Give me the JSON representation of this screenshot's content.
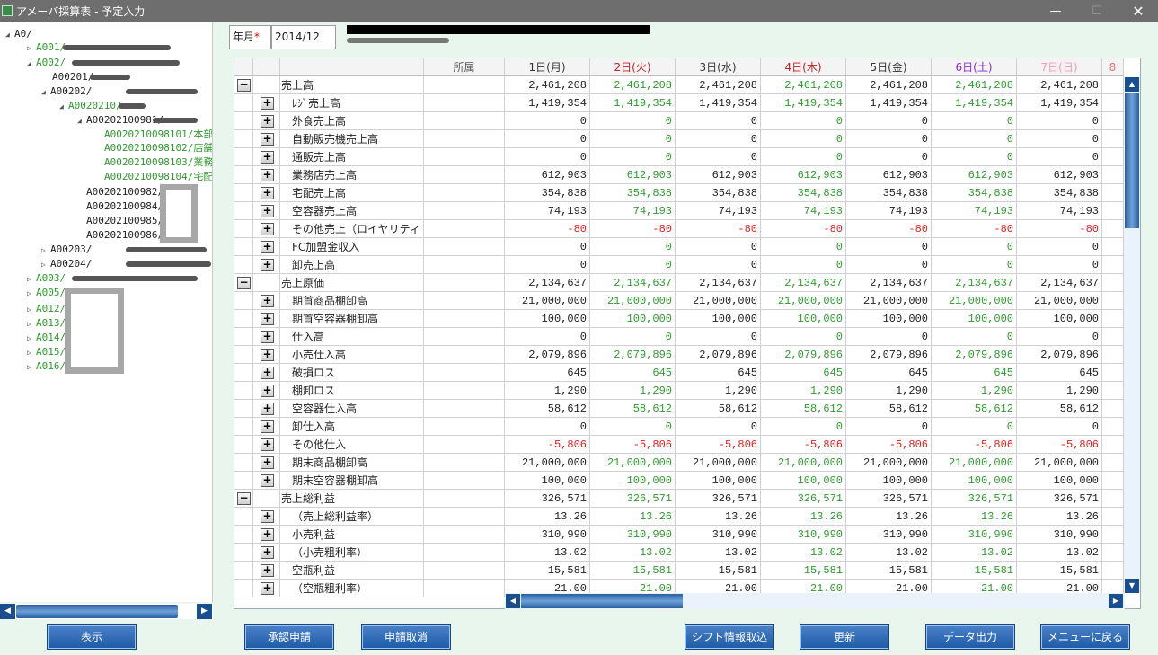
{
  "window": {
    "title": "アメーバ採算表 - 予定入力",
    "minimize": "—",
    "maximize": "☐",
    "close": "✕"
  },
  "tree": {
    "nodes": [
      {
        "label": "A0/",
        "color": "black",
        "arrow": "◢"
      },
      {
        "label": "A001/",
        "color": "green",
        "arrow": "▷"
      },
      {
        "label": "A002/",
        "color": "green",
        "arrow": "◢"
      },
      {
        "label": "A00201/",
        "color": "black",
        "arrow": ""
      },
      {
        "label": "A00202/",
        "color": "black",
        "arrow": "◢"
      },
      {
        "label": "A0020210/",
        "color": "green",
        "arrow": "◢"
      },
      {
        "label": "A00202100981/",
        "color": "black",
        "arrow": "◢"
      },
      {
        "label": "A0020210098101/本部",
        "color": "green",
        "arrow": ""
      },
      {
        "label": "A0020210098102/店舗",
        "color": "green",
        "arrow": ""
      },
      {
        "label": "A0020210098103/業務",
        "color": "green",
        "arrow": ""
      },
      {
        "label": "A0020210098104/宅配",
        "color": "green",
        "arrow": ""
      },
      {
        "label": "A00202100982/",
        "color": "black",
        "arrow": ""
      },
      {
        "label": "A00202100984/",
        "color": "black",
        "arrow": ""
      },
      {
        "label": "A00202100985/",
        "color": "black",
        "arrow": ""
      },
      {
        "label": "A00202100986/",
        "color": "black",
        "arrow": ""
      },
      {
        "label": "A00203/",
        "color": "black",
        "arrow": "▷"
      },
      {
        "label": "A00204/",
        "color": "black",
        "arrow": "▷"
      },
      {
        "label": "A003/",
        "color": "green",
        "arrow": "▷"
      },
      {
        "label": "A005/",
        "color": "green",
        "arrow": "▷"
      },
      {
        "label": "A012/",
        "color": "green",
        "arrow": "▷"
      },
      {
        "label": "A013/",
        "color": "green",
        "arrow": "▷"
      },
      {
        "label": "A014/",
        "color": "green",
        "arrow": "▷"
      },
      {
        "label": "A015/",
        "color": "green",
        "arrow": "▷"
      },
      {
        "label": "A016/",
        "color": "green",
        "arrow": "▷"
      }
    ]
  },
  "form": {
    "ym_label": "年月",
    "ym_required": "*",
    "ym_value": "2014/12"
  },
  "grid": {
    "dept_header": "所属",
    "days": [
      {
        "label": "1日(月)",
        "style": "d1"
      },
      {
        "label": "2日(火)",
        "style": "red"
      },
      {
        "label": "3日(水)",
        "style": "d1"
      },
      {
        "label": "4日(木)",
        "style": "red"
      },
      {
        "label": "5日(金)",
        "style": "d1"
      },
      {
        "label": "6日(土)",
        "style": "purple"
      },
      {
        "label": "7日(日)",
        "style": "pink"
      }
    ],
    "rows": [
      {
        "name": "売上高",
        "level": 0,
        "toggle": "−",
        "v": [
          "2,461,208",
          "2,461,208",
          "2,461,208",
          "2,461,208",
          "2,461,208",
          "2,461,208",
          "2,461,208"
        ]
      },
      {
        "name": "ﾚｼﾞ売上高",
        "level": 1,
        "toggle": "+",
        "v": [
          "1,419,354",
          "1,419,354",
          "1,419,354",
          "1,419,354",
          "1,419,354",
          "1,419,354",
          "1,419,354"
        ]
      },
      {
        "name": "外食売上高",
        "level": 1,
        "toggle": "+",
        "v": [
          "0",
          "0",
          "0",
          "0",
          "0",
          "0",
          "0"
        ]
      },
      {
        "name": "自動販売機売上高",
        "level": 1,
        "toggle": "+",
        "v": [
          "0",
          "0",
          "0",
          "0",
          "0",
          "0",
          "0"
        ]
      },
      {
        "name": "通販売上高",
        "level": 1,
        "toggle": "+",
        "v": [
          "0",
          "0",
          "0",
          "0",
          "0",
          "0",
          "0"
        ]
      },
      {
        "name": "業務店売上高",
        "level": 1,
        "toggle": "+",
        "v": [
          "612,903",
          "612,903",
          "612,903",
          "612,903",
          "612,903",
          "612,903",
          "612,903"
        ]
      },
      {
        "name": "宅配売上高",
        "level": 1,
        "toggle": "+",
        "v": [
          "354,838",
          "354,838",
          "354,838",
          "354,838",
          "354,838",
          "354,838",
          "354,838"
        ]
      },
      {
        "name": "空容器売上高",
        "level": 1,
        "toggle": "+",
        "v": [
          "74,193",
          "74,193",
          "74,193",
          "74,193",
          "74,193",
          "74,193",
          "74,193"
        ]
      },
      {
        "name": "その他売上（ロイヤリティ",
        "level": 1,
        "toggle": "+",
        "neg": true,
        "v": [
          "-80",
          "-80",
          "-80",
          "-80",
          "-80",
          "-80",
          "-80"
        ]
      },
      {
        "name": "FC加盟金収入",
        "level": 1,
        "toggle": "+",
        "v": [
          "0",
          "0",
          "0",
          "0",
          "0",
          "0",
          "0"
        ]
      },
      {
        "name": "卸売上高",
        "level": 1,
        "toggle": "+",
        "v": [
          "0",
          "0",
          "0",
          "0",
          "0",
          "0",
          "0"
        ]
      },
      {
        "name": "売上原価",
        "level": 0,
        "toggle": "−",
        "v": [
          "2,134,637",
          "2,134,637",
          "2,134,637",
          "2,134,637",
          "2,134,637",
          "2,134,637",
          "2,134,637"
        ]
      },
      {
        "name": "期首商品棚卸高",
        "level": 1,
        "toggle": "+",
        "v": [
          "21,000,000",
          "21,000,000",
          "21,000,000",
          "21,000,000",
          "21,000,000",
          "21,000,000",
          "21,000,000"
        ]
      },
      {
        "name": "期首空容器棚卸高",
        "level": 1,
        "toggle": "+",
        "v": [
          "100,000",
          "100,000",
          "100,000",
          "100,000",
          "100,000",
          "100,000",
          "100,000"
        ]
      },
      {
        "name": "仕入高",
        "level": 1,
        "toggle": "+",
        "v": [
          "0",
          "0",
          "0",
          "0",
          "0",
          "0",
          "0"
        ]
      },
      {
        "name": "小売仕入高",
        "level": 1,
        "toggle": "+",
        "v": [
          "2,079,896",
          "2,079,896",
          "2,079,896",
          "2,079,896",
          "2,079,896",
          "2,079,896",
          "2,079,896"
        ]
      },
      {
        "name": "破損ロス",
        "level": 1,
        "toggle": "+",
        "v": [
          "645",
          "645",
          "645",
          "645",
          "645",
          "645",
          "645"
        ]
      },
      {
        "name": "棚卸ロス",
        "level": 1,
        "toggle": "+",
        "v": [
          "1,290",
          "1,290",
          "1,290",
          "1,290",
          "1,290",
          "1,290",
          "1,290"
        ]
      },
      {
        "name": "空容器仕入高",
        "level": 1,
        "toggle": "+",
        "v": [
          "58,612",
          "58,612",
          "58,612",
          "58,612",
          "58,612",
          "58,612",
          "58,612"
        ]
      },
      {
        "name": "卸仕入高",
        "level": 1,
        "toggle": "+",
        "v": [
          "0",
          "0",
          "0",
          "0",
          "0",
          "0",
          "0"
        ]
      },
      {
        "name": "その他仕入",
        "level": 1,
        "toggle": "+",
        "neg": true,
        "v": [
          "-5,806",
          "-5,806",
          "-5,806",
          "-5,806",
          "-5,806",
          "-5,806",
          "-5,806"
        ]
      },
      {
        "name": "期末商品棚卸高",
        "level": 1,
        "toggle": "+",
        "v": [
          "21,000,000",
          "21,000,000",
          "21,000,000",
          "21,000,000",
          "21,000,000",
          "21,000,000",
          "21,000,000"
        ]
      },
      {
        "name": "期末空容器棚卸高",
        "level": 1,
        "toggle": "+",
        "v": [
          "100,000",
          "100,000",
          "100,000",
          "100,000",
          "100,000",
          "100,000",
          "100,000"
        ]
      },
      {
        "name": "売上総利益",
        "level": 0,
        "toggle": "−",
        "v": [
          "326,571",
          "326,571",
          "326,571",
          "326,571",
          "326,571",
          "326,571",
          "326,571"
        ]
      },
      {
        "name": "（売上総利益率）",
        "level": 1,
        "toggle": "+",
        "v": [
          "13.26",
          "13.26",
          "13.26",
          "13.26",
          "13.26",
          "13.26",
          "13.26"
        ]
      },
      {
        "name": "小売利益",
        "level": 1,
        "toggle": "+",
        "v": [
          "310,990",
          "310,990",
          "310,990",
          "310,990",
          "310,990",
          "310,990",
          "310,990"
        ]
      },
      {
        "name": "（小売粗利率）",
        "level": 1,
        "toggle": "+",
        "v": [
          "13.02",
          "13.02",
          "13.02",
          "13.02",
          "13.02",
          "13.02",
          "13.02"
        ]
      },
      {
        "name": "空瓶利益",
        "level": 1,
        "toggle": "+",
        "v": [
          "15,581",
          "15,581",
          "15,581",
          "15,581",
          "15,581",
          "15,581",
          "15,581"
        ]
      },
      {
        "name": "（空瓶粗利率）",
        "level": 1,
        "toggle": "+",
        "v": [
          "21.00",
          "21.00",
          "21.00",
          "21.00",
          "21.00",
          "21.00",
          "21.00"
        ]
      }
    ]
  },
  "buttons": {
    "show": "表示",
    "approve": "承認申請",
    "cancel": "申請取消",
    "shift": "シフト情報取込",
    "update": "更新",
    "export": "データ出力",
    "menu": "メニューに戻る"
  }
}
